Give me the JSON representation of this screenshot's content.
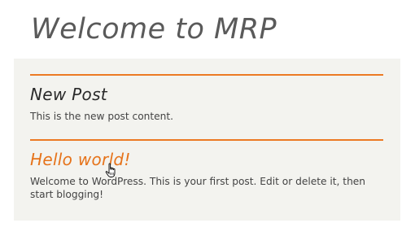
{
  "site": {
    "title": "Welcome to MRP"
  },
  "posts": [
    {
      "title": "New Post",
      "content": "This is the new post content.",
      "is_link": false
    },
    {
      "title": "Hello world!",
      "content": "Welcome to WordPress. This is your first post. Edit or delete it, then start blogging!",
      "is_link": true
    }
  ],
  "colors": {
    "accent": "#ec7a24",
    "link": "#e6731a",
    "content_bg": "#f3f3ef",
    "title_text": "#5a5a5a"
  },
  "icons": {
    "cursor": "hand-pointer-icon"
  }
}
